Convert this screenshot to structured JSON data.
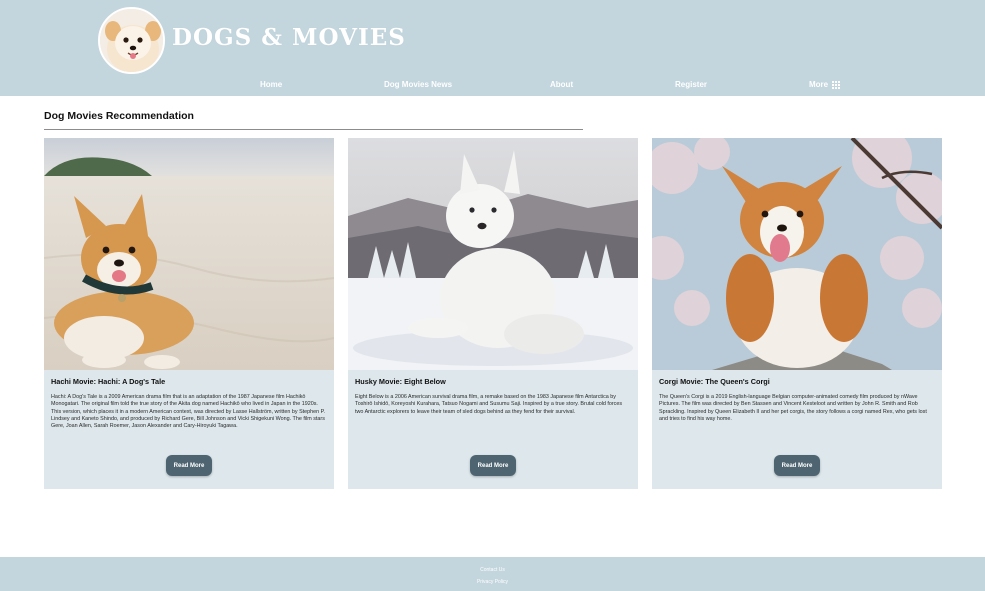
{
  "header": {
    "brand": "DOGS & MOVIES",
    "nav": {
      "home": "Home",
      "news": "Dog Movies News",
      "about": "About",
      "register": "Register",
      "more": "More"
    }
  },
  "main": {
    "section_title": "Dog Movies Recommendation",
    "cards": [
      {
        "title": "Hachi Movie: Hachi: A Dog's Tale",
        "text": "Hachi: A Dog's Tale is a 2009 American drama film that is an adaptation of the 1987 Japanese film Hachikō Monogatari. The original film told the true story of the Akita dog named Hachikō who lived in Japan in the 1920s. This version, which places it in a modern American context, was directed by Lasse Hallström, written by Stephen P. Lindsey and Kaneto Shindo, and produced by Richard Gere, Bill Johnson and Vicki Shigekuni Wong. The film stars Gere, Joan Allen, Sarah Roemer, Jason Alexander and Cary-Hiroyuki Tagawa.",
        "button": "Read More"
      },
      {
        "title": "Husky Movie: Eight Below",
        "text": "Eight Below is a 2006 American survival drama film, a remake based on the 1983 Japanese film Antarctica by Toshirō Ishidō, Koreyoshi Kurahara, Tatsuo Nogami and Susumu Saji. Inspired by a true story. Brutal cold forces two Antarctic explorers to leave their team of sled dogs behind as they fend for their survival.",
        "button": "Read More"
      },
      {
        "title": "Corgi Movie: The Queen's Corgi",
        "text": "The Queen's Corgi is a 2019 English-language Belgian computer-animated comedy film produced by nWave Pictures. The film was directed by Ben Stassen and Vincent Kesteloot and written by John R. Smith and Rob Sprackling. Inspired by Queen Elizabeth II and her pet corgis, the story follows a corgi named Rex, who gets lost and tries to find his way home.",
        "button": "Read More"
      }
    ]
  },
  "footer": {
    "contact": "Contact Us",
    "privacy": "Privacy Policy"
  },
  "colors": {
    "header_bg": "#c3d5dd",
    "card_bg": "#dde7ec",
    "button_bg": "#4e6571"
  },
  "icons": {
    "logo": "pomeranian-logo",
    "more": "grid-icon"
  }
}
